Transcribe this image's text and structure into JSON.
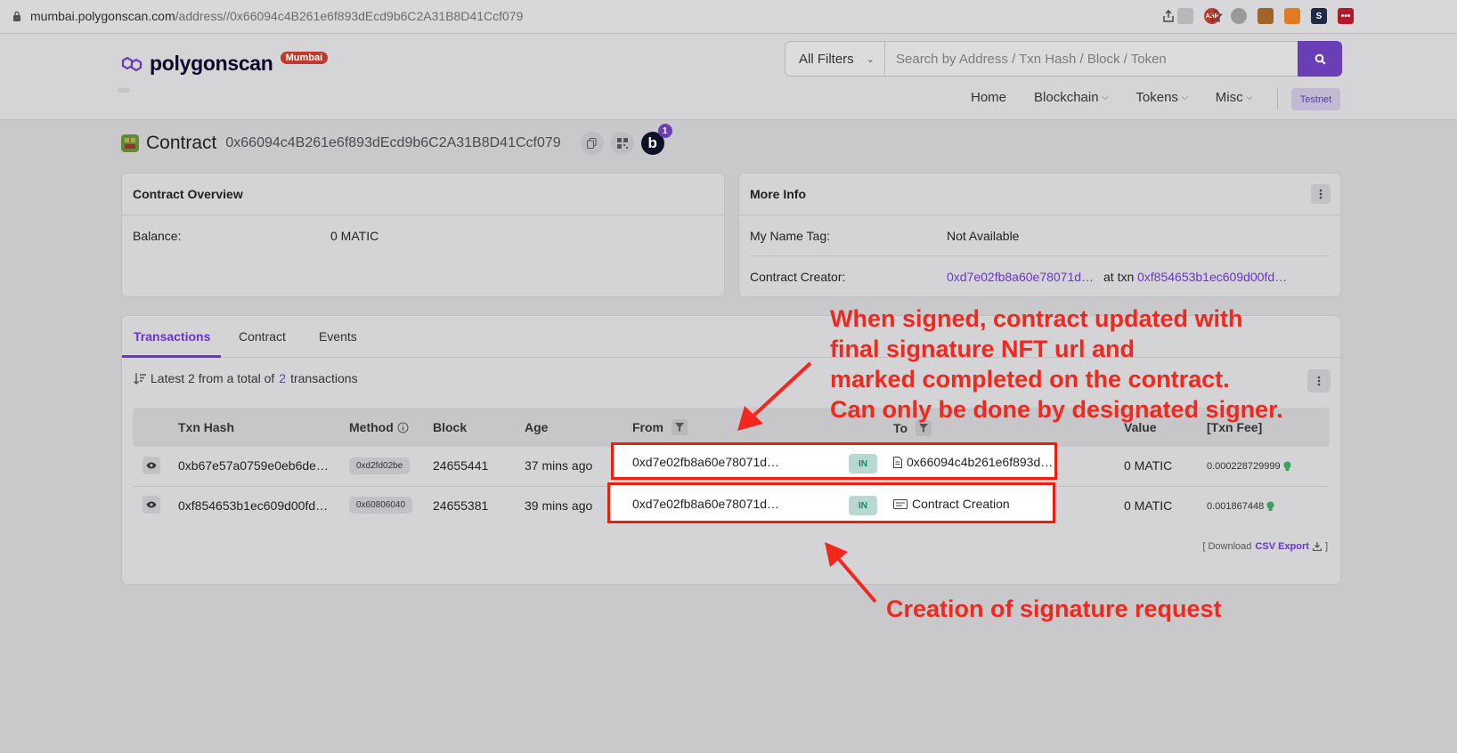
{
  "browser": {
    "url_host": "mumbai.polygonscan.com",
    "url_path": "/address//0x66094c4B261e6f893dEcd9b6C2A31B8D41Ccf079"
  },
  "header": {
    "logo_text": "polygonscan",
    "network_badge": "Mumbai",
    "filter_label": "All Filters",
    "search_placeholder": "Search by Address / Txn Hash / Block / Token",
    "nav": [
      "Home",
      "Blockchain",
      "Tokens",
      "Misc"
    ],
    "testnet_label": "Testnet",
    "notification_count": "1",
    "b_label": "b"
  },
  "contract": {
    "label": "Contract",
    "address": "0x66094c4B261e6f893dEcd9b6C2A31B8D41Ccf079"
  },
  "overview": {
    "title": "Contract Overview",
    "balance_label": "Balance:",
    "balance_value": "0 MATIC"
  },
  "more_info": {
    "title": "More Info",
    "name_tag_label": "My Name Tag:",
    "name_tag_value": "Not Available",
    "creator_label": "Contract Creator:",
    "creator_address": "0xd7e02fb8a60e78071d…",
    "at_txn_label": "at txn",
    "creator_txn": "0xf854653b1ec609d00fd…"
  },
  "transactions": {
    "tabs": [
      "Transactions",
      "Contract",
      "Events"
    ],
    "summary_prefix": "Latest 2 from a total of",
    "summary_count": "2",
    "summary_suffix": "transactions",
    "columns": {
      "txn_hash": "Txn Hash",
      "method": "Method",
      "block": "Block",
      "age": "Age",
      "from": "From",
      "to": "To",
      "value": "Value",
      "fee": "[Txn Fee]"
    },
    "rows": [
      {
        "hash": "0xb67e57a0759e0eb6de…",
        "method": "0xd2fd02be",
        "block": "24655441",
        "age": "37 mins ago",
        "from": "0xd7e02fb8a60e78071d…",
        "direction": "IN",
        "to": "0x66094c4b261e6f893d…",
        "value": "0 MATIC",
        "fee": "0.000228729999"
      },
      {
        "hash": "0xf854653b1ec609d00fd…",
        "method": "0x60806040",
        "block": "24655381",
        "age": "39 mins ago",
        "from": "0xd7e02fb8a60e78071d…",
        "direction": "IN",
        "to": "Contract Creation",
        "value": "0 MATIC",
        "fee": "0.001867448"
      }
    ],
    "download_prefix": "[ Download",
    "download_link": "CSV Export",
    "download_suffix": "]"
  },
  "annotations": {
    "top_lines": [
      "When signed, contract updated with",
      "final signature NFT url and",
      "marked completed on the contract.",
      "Can only be done by designated signer."
    ],
    "bottom": "Creation of signature request"
  },
  "colors": {
    "accent": "#6a3fb5",
    "link": "#6a35c9",
    "annotation": "#f2271d",
    "network_badge": "#c0392b"
  }
}
